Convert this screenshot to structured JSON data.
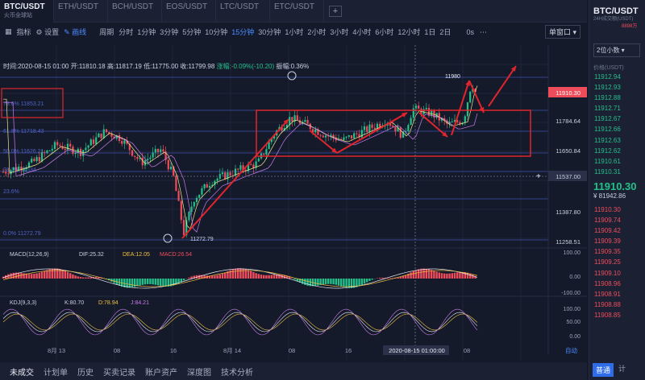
{
  "tabs": [
    {
      "label": "BTC/USDT",
      "sub": "火币全球站",
      "active": true
    },
    {
      "label": "ETH/USDT",
      "sub": "",
      "active": false
    },
    {
      "label": "BCH/USDT",
      "sub": "",
      "active": false
    },
    {
      "label": "EOS/USDT",
      "sub": "",
      "active": false
    },
    {
      "label": "LTC/USDT",
      "sub": "",
      "active": false
    },
    {
      "label": "ETC/USDT",
      "sub": "",
      "active": false
    }
  ],
  "add_tab": "+",
  "toolbar": {
    "indicators": "指标",
    "settings": "设置",
    "draw": "画线",
    "period_label": "周期",
    "window": "单窗口"
  },
  "periods": [
    "分时",
    "1分钟",
    "3分钟",
    "5分钟",
    "10分钟",
    "15分钟",
    "30分钟",
    "1小时",
    "2小时",
    "3小时",
    "4小时",
    "6小时",
    "12小时",
    "1日",
    "2日"
  ],
  "active_period": "15分钟",
  "right_icons": [
    "0s",
    "⋯"
  ],
  "ohlc": {
    "time": "时间:2020-08-15 01:00",
    "open": "开:11810.18",
    "high": "高:11817.19",
    "low": "低:11775.00",
    "close": "收:11799.98",
    "chg": "涨幅:-0.09%(-10.20)",
    "amp": "振幅:0.36%"
  },
  "price_axis": [
    "11910.30",
    "11784.64",
    "11650.84",
    "11537.00",
    "11387.80",
    "11258.51"
  ],
  "price_labels": {
    "high_marker": "11980",
    "low_marker": "11272.79"
  },
  "fib_labels": [
    "78.6% 11853.21",
    "61.8% 11718.43",
    "50.0% 11626.21",
    "38.2% 11534",
    "23.6%",
    "0.0% 11272.79"
  ],
  "macd": {
    "title": "MACD(12,26,9)",
    "dif": "DIF:25.32",
    "dea": "DEA:12.05",
    "macd": "MACD:26.54",
    "axis": [
      "100.00",
      "0.00",
      "-100.00"
    ]
  },
  "kdj": {
    "title": "KDJ(9,3,3)",
    "k": "K:80.70",
    "d": "D:78.94",
    "j": "J:84.21",
    "axis": [
      "100.00",
      "50.00",
      "0.00"
    ]
  },
  "time_axis": [
    "8月 13",
    "08",
    "16",
    "8月 14",
    "08",
    "16",
    "2020-08-15 01:00:00",
    "08"
  ],
  "auto_label": "自动",
  "bottom_tabs": [
    "未成交",
    "计划单",
    "历史",
    "买卖记录",
    "账户资产",
    "深度图",
    "技术分析"
  ],
  "side": {
    "symbol": "BTC/USDT",
    "exch_line": "24H成交额(USDT)",
    "price_small": "8898万",
    "dropdown": "2位小数",
    "header": "价格(USDT)",
    "asks": [
      "11912.94",
      "11912.93",
      "11912.88",
      "11912.71",
      "11912.67",
      "11912.66",
      "11912.63",
      "11912.62",
      "11910.61",
      "11910.31"
    ],
    "last": "11910.30",
    "cny": "¥ 81942.86",
    "bids": [
      "11910.30",
      "11909.74",
      "11909.42",
      "11909.39",
      "11909.35",
      "11909.25",
      "11909.10",
      "11908.96",
      "11908.91",
      "11908.88",
      "11908.85"
    ],
    "foot": [
      "普通",
      "计"
    ]
  },
  "colors": {
    "up": "#23c08a",
    "down": "#ef4c5b",
    "bg": "#151a2b",
    "accent": "#4a8cff",
    "annot": "#e2252d"
  }
}
